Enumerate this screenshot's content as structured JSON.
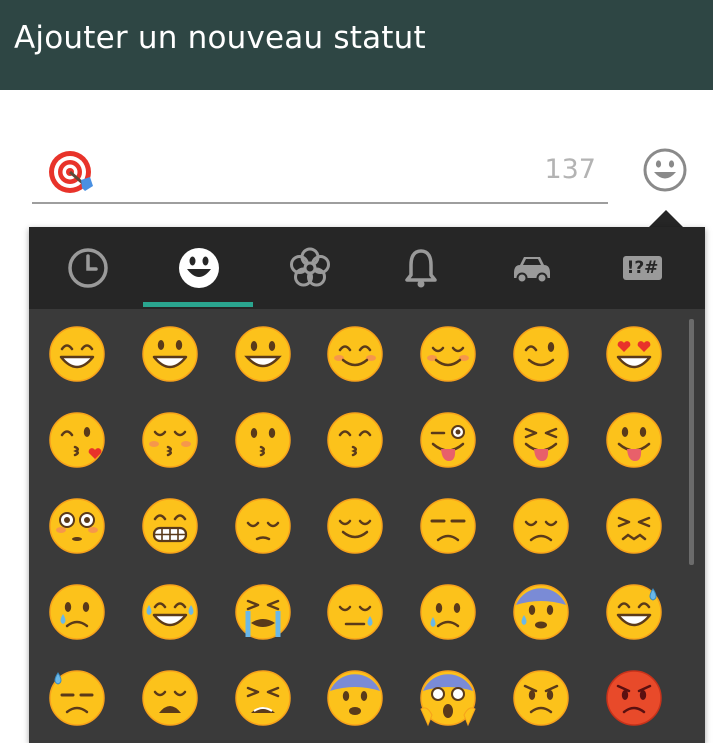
{
  "header": {
    "title": "Ajouter un nouveau statut"
  },
  "status_input": {
    "value_icon": "direct-hit-target-icon",
    "char_counter": "137"
  },
  "emoji_toggle_icon": "smiley-face-icon",
  "emoji_panel": {
    "tabs": [
      {
        "name": "recent",
        "icon": "clock-icon",
        "selected": false
      },
      {
        "name": "people",
        "icon": "smiley-icon",
        "selected": true
      },
      {
        "name": "nature",
        "icon": "flower-icon",
        "selected": false
      },
      {
        "name": "objects",
        "icon": "bell-icon",
        "selected": false
      },
      {
        "name": "places",
        "icon": "car-icon",
        "selected": false
      },
      {
        "name": "symbols",
        "label": "!?#",
        "selected": false
      }
    ],
    "accent_color": "#2aa58f",
    "emojis": [
      [
        "grinning-face",
        "grinning-face-big-eyes",
        "grinning-face-simple",
        "smiling-face-blush",
        "relaxed-face",
        "winking-face",
        "heart-eyes-face"
      ],
      [
        "face-blowing-kiss",
        "kissing-closed-eyes",
        "kissing-face",
        "kissing-smiling-eyes",
        "winking-tongue-face",
        "squinting-tongue-face",
        "tongue-face"
      ],
      [
        "flushed-face",
        "grimacing-face",
        "pensive-face",
        "relieved-face",
        "unamused-face",
        "disappointed-face",
        "confounded-face"
      ],
      [
        "crying-face",
        "tears-of-joy-face",
        "loudly-crying-face",
        "sleepy-face",
        "sad-relieved-face",
        "anxious-sweat-face",
        "grinning-sweat-face"
      ],
      [
        "downcast-sweat-face",
        "weary-face",
        "tired-face",
        "fearful-face",
        "screaming-face",
        "angry-face",
        "pouting-red-face"
      ]
    ]
  }
}
